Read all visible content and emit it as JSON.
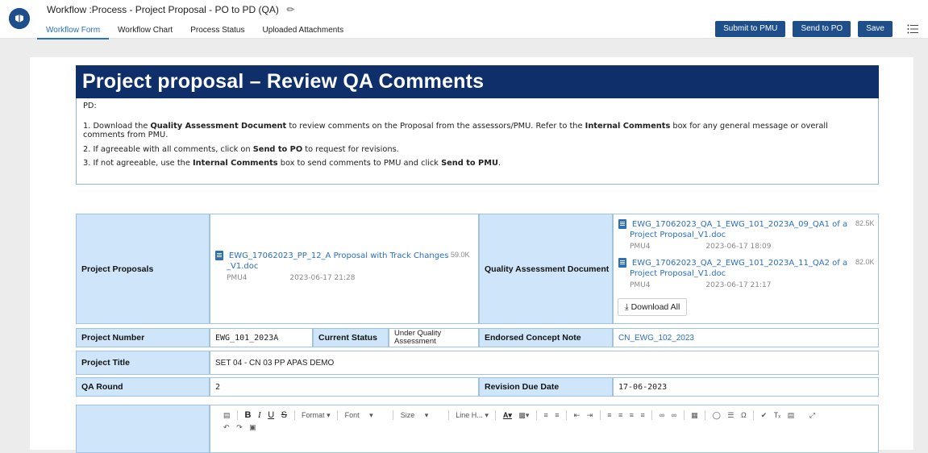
{
  "header": {
    "title": "Workflow :Process - Project Proposal - PO to PD (QA)",
    "tabs": [
      {
        "label": "Workflow Form"
      },
      {
        "label": "Workflow Chart"
      },
      {
        "label": "Process Status"
      },
      {
        "label": "Uploaded Attachments"
      }
    ],
    "buttons": {
      "submit_pmu": "Submit to PMU",
      "send_po": "Send to PO",
      "save": "Save"
    }
  },
  "banner": {
    "title": "Project proposal – Review QA Comments"
  },
  "instructions": {
    "salutation": "PD:",
    "step1_a": "1. Download the ",
    "step1_b": "Quality Assessment Document",
    "step1_c": " to review comments on the Proposal from the assessors/PMU. Refer to the ",
    "step1_d": "Internal Comments",
    "step1_e": " box for any general message or overall comments from PMU.",
    "step2_a": "2. If agreeable with all comments, click on ",
    "step2_b": "Send to PO",
    "step2_c": " to request for revisions.",
    "step3_a": "3. If not agreeable, use the ",
    "step3_b": "Internal Comments",
    "step3_c": " box to send comments to PMU and click ",
    "step3_d": "Send to PMU",
    "step3_e": "."
  },
  "table": {
    "proposals_label": "Project Proposals",
    "proposal_file": {
      "name_line1": "EWG_17062023_PP_12_A Proposal with Track Changes",
      "name_line2": "_V1.doc",
      "size": "59.0K",
      "user": "PMU4",
      "date": "2023-06-17 21:28"
    },
    "qa_label": "Quality Assessment Document",
    "qa_files": [
      {
        "name_line1": "EWG_17062023_QA_1_EWG_101_2023A_09_QA1 of a",
        "name_line2": "Project Proposal_V1.doc",
        "size": "82.5K",
        "user": "PMU4",
        "date": "2023-06-17 18:09"
      },
      {
        "name_line1": "EWG_17062023_QA_2_EWG_101_2023A_11_QA2 of a",
        "name_line2": "Project Proposal_V1.doc",
        "size": "82.0K",
        "user": "PMU4",
        "date": "2023-06-17 21:17"
      }
    ],
    "download_all": "Download All",
    "project_number_label": "Project Number",
    "project_number": "EWG_101_2023A",
    "current_status_label": "Current Status",
    "current_status": "Under Quality Assessment",
    "endorsed_label": "Endorsed Concept Note",
    "endorsed_value": "CN_EWG_102_2023",
    "project_title_label": "Project Title",
    "project_title": "SET 04 - CN 03 PP APAS DEMO",
    "qa_round_label": "QA Round",
    "qa_round": "2",
    "revision_due_label": "Revision Due Date",
    "revision_due": "17-06-2023"
  },
  "editor": {
    "format_label": "Format",
    "font_label": "Font",
    "size_label": "Size",
    "line_height_label": "Line H..."
  },
  "colors": {
    "brand": "#1f4f8a",
    "banner": "#0f2f6b",
    "label_bg": "#cfe6fa",
    "link": "#2a6fc1"
  }
}
